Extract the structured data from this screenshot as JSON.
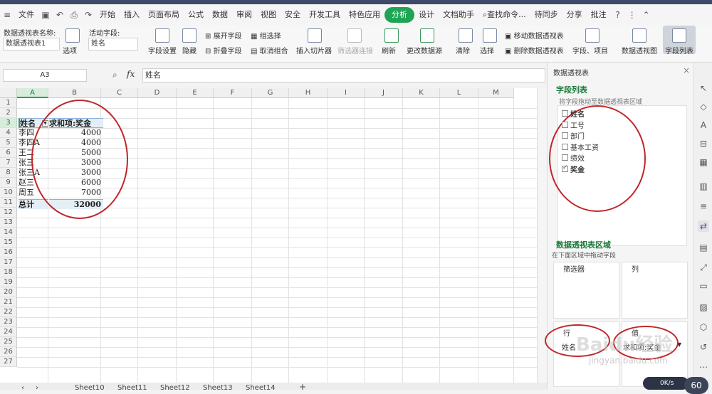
{
  "app": {
    "menu": [
      "文件"
    ],
    "tabs": [
      "开始",
      "插入",
      "页面布局",
      "公式",
      "数据",
      "审阅",
      "视图",
      "安全",
      "开发工具",
      "特色应用",
      "分析",
      "设计",
      "文档助手"
    ],
    "active_tab": "分析",
    "search": "查找命令...",
    "right_items": [
      "待同步",
      "分享",
      "批注"
    ]
  },
  "ribbon": {
    "pivot_name_label": "数据透视表名称:",
    "pivot_name_value": "数据透视表1",
    "options": "选项",
    "active_field_label": "活动字段:",
    "active_field_value": "姓名",
    "field_settings": "字段设置",
    "hide": "隐藏",
    "expand_field": "展开字段",
    "collapse_field": "折叠字段",
    "group_select": "组选择",
    "ungroup": "取消组合",
    "insert_slicer": "插入切片器",
    "filter_connect": "筛选器连接",
    "refresh": "刷新",
    "change_source": "更改数据源",
    "clear": "清除",
    "select": "选择",
    "move_pivot": "移动数据透视表",
    "delete_pivot": "删除数据透视表",
    "fields_items": "字段、项目",
    "pivot_chart": "数据透视图",
    "field_list": "字段列表"
  },
  "formula": {
    "name_box": "A3",
    "fx": "fx",
    "value": "姓名"
  },
  "grid": {
    "columns": [
      "A",
      "B",
      "C",
      "D",
      "E",
      "F",
      "G",
      "H",
      "I",
      "J",
      "K",
      "L",
      "M"
    ],
    "rows": [
      "1",
      "2",
      "3",
      "4",
      "5",
      "6",
      "7",
      "8",
      "9",
      "10",
      "11",
      "12",
      "13",
      "14",
      "15",
      "16",
      "17",
      "18",
      "19",
      "20",
      "21",
      "22",
      "23",
      "24",
      "25",
      "26",
      "27"
    ],
    "header_a": "姓名",
    "header_b": "求和项:奖金",
    "data": [
      {
        "name": "李四",
        "value": "4000"
      },
      {
        "name": "李四A",
        "value": "4000"
      },
      {
        "name": "王二",
        "value": "5000"
      },
      {
        "name": "张三",
        "value": "3000"
      },
      {
        "name": "张三A",
        "value": "3000"
      },
      {
        "name": "赵三",
        "value": "6000"
      },
      {
        "name": "周五",
        "value": "7000"
      }
    ],
    "total_label": "总计",
    "total_value": "32000"
  },
  "sheets": [
    "Sheet10",
    "Sheet11",
    "Sheet12",
    "Sheet13",
    "Sheet14"
  ],
  "panel": {
    "title": "数据透视表",
    "field_list_title": "字段列表",
    "field_list_hint": "将字段拖动至数据透视表区域",
    "fields": [
      {
        "label": "姓名",
        "checked": false,
        "bold": true
      },
      {
        "label": "工号",
        "checked": false,
        "bold": false
      },
      {
        "label": "部门",
        "checked": false,
        "bold": false
      },
      {
        "label": "基本工资",
        "checked": false,
        "bold": false
      },
      {
        "label": "绩效",
        "checked": false,
        "bold": false
      },
      {
        "label": "奖金",
        "checked": true,
        "bold": true
      }
    ],
    "areas_title": "数据透视表区域",
    "areas_hint": "在下面区域中拖动字段",
    "filter_label": "筛选器",
    "col_label": "列",
    "row_label": "行",
    "value_label": "值",
    "row_item": "姓名",
    "value_item": "求和项:奖金"
  },
  "status": {
    "speed": "0K/s",
    "num": "60"
  },
  "watermark": {
    "brand": "Baidu经验",
    "url": "jingyan.baidu.com"
  },
  "colors": {
    "accent": "#1fa455",
    "annotation": "#c0262a"
  }
}
